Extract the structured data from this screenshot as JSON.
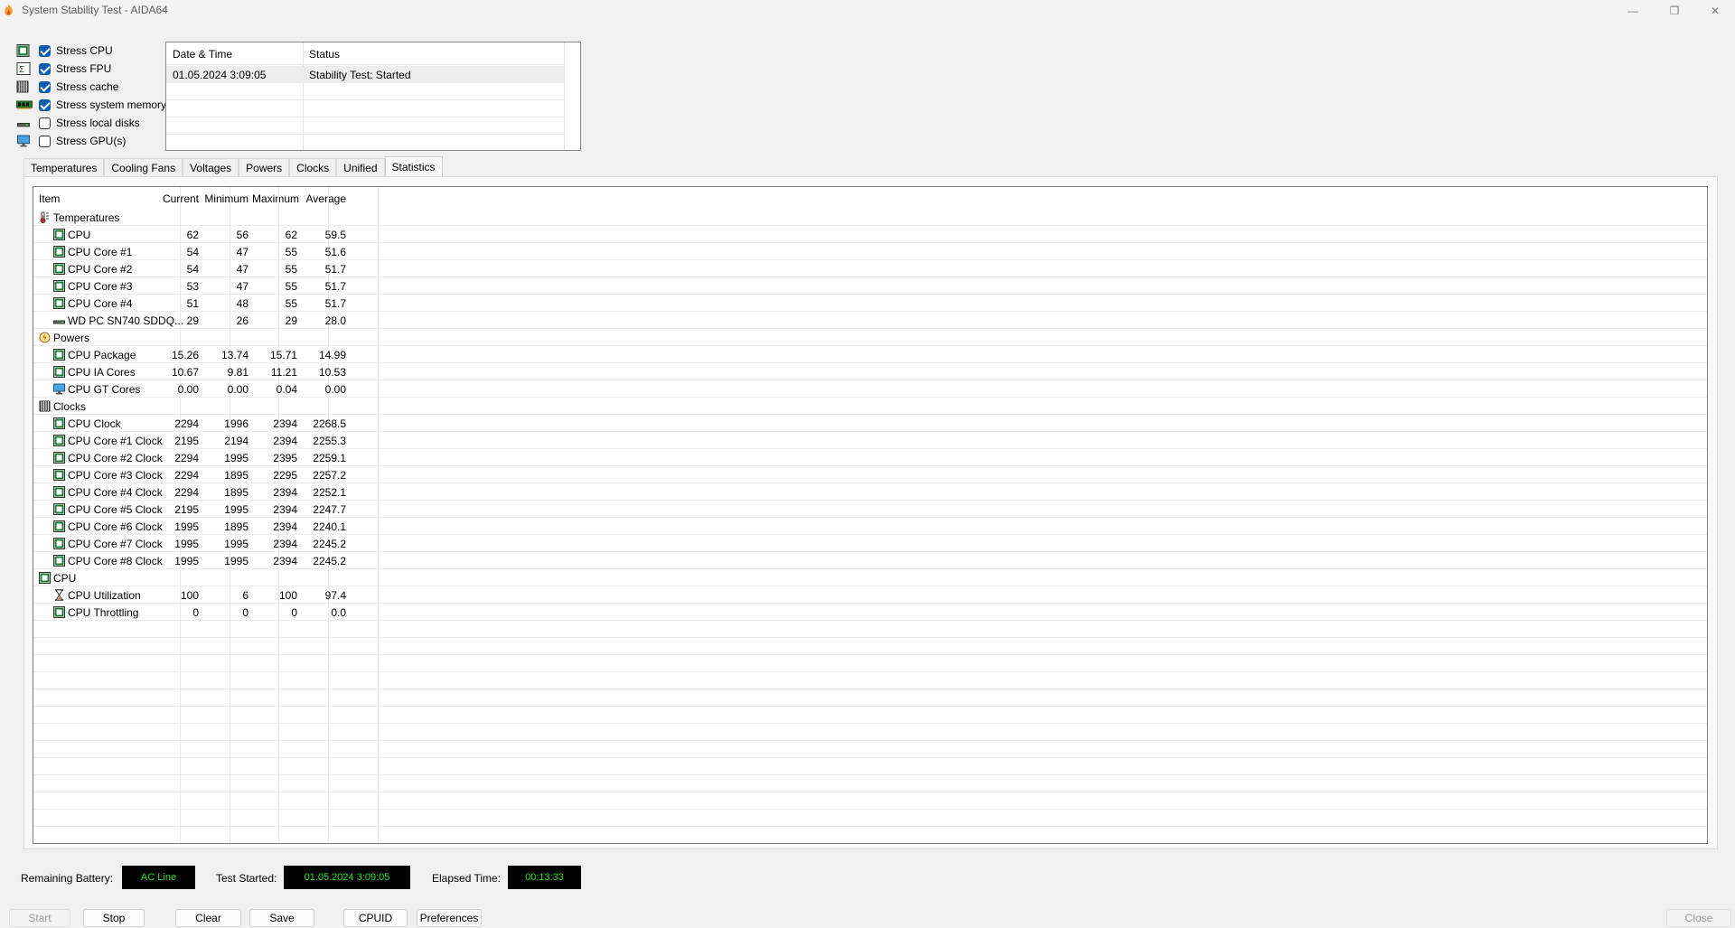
{
  "window": {
    "title": "System Stability Test - AIDA64",
    "controls": {
      "minimize": "—",
      "maximize": "❐",
      "close": "✕"
    }
  },
  "stress": [
    {
      "label": "Stress CPU",
      "checked": true,
      "icon": "cpu-chip-icon"
    },
    {
      "label": "Stress FPU",
      "checked": true,
      "icon": "fpu-icon"
    },
    {
      "label": "Stress cache",
      "checked": true,
      "icon": "cache-icon"
    },
    {
      "label": "Stress system memory",
      "checked": true,
      "icon": "memory-icon"
    },
    {
      "label": "Stress local disks",
      "checked": false,
      "icon": "disk-icon"
    },
    {
      "label": "Stress GPU(s)",
      "checked": false,
      "icon": "monitor-icon"
    }
  ],
  "log": {
    "headers": [
      "Date & Time",
      "Status"
    ],
    "rows": [
      {
        "datetime": "01.05.2024 3:09:05",
        "status": "Stability Test: Started"
      }
    ]
  },
  "tabs": [
    "Temperatures",
    "Cooling Fans",
    "Voltages",
    "Powers",
    "Clocks",
    "Unified",
    "Statistics"
  ],
  "active_tab": "Statistics",
  "grid": {
    "headers": {
      "item": "Item",
      "current": "Current",
      "minimum": "Minimum",
      "maximum": "Maximum",
      "average": "Average"
    },
    "rows": [
      {
        "type": "group",
        "icon": "thermometer-icon",
        "item": "Temperatures"
      },
      {
        "type": "item",
        "icon": "cpu-chip-icon",
        "item": "CPU",
        "current": "62",
        "minimum": "56",
        "maximum": "62",
        "average": "59.5"
      },
      {
        "type": "item",
        "icon": "cpu-chip-icon",
        "item": "CPU Core #1",
        "current": "54",
        "minimum": "47",
        "maximum": "55",
        "average": "51.6"
      },
      {
        "type": "item",
        "icon": "cpu-chip-icon",
        "item": "CPU Core #2",
        "current": "54",
        "minimum": "47",
        "maximum": "55",
        "average": "51.7"
      },
      {
        "type": "item",
        "icon": "cpu-chip-icon",
        "item": "CPU Core #3",
        "current": "53",
        "minimum": "47",
        "maximum": "55",
        "average": "51.7"
      },
      {
        "type": "item",
        "icon": "cpu-chip-icon",
        "item": "CPU Core #4",
        "current": "51",
        "minimum": "48",
        "maximum": "55",
        "average": "51.7"
      },
      {
        "type": "item",
        "icon": "disk-icon",
        "item": "WD PC SN740 SDDQ...",
        "current": "29",
        "minimum": "26",
        "maximum": "29",
        "average": "28.0"
      },
      {
        "type": "group",
        "icon": "power-icon",
        "item": "Powers"
      },
      {
        "type": "item",
        "icon": "cpu-chip-icon",
        "item": "CPU Package",
        "current": "15.26",
        "minimum": "13.74",
        "maximum": "15.71",
        "average": "14.99"
      },
      {
        "type": "item",
        "icon": "cpu-chip-icon",
        "item": "CPU IA Cores",
        "current": "10.67",
        "minimum": "9.81",
        "maximum": "11.21",
        "average": "10.53"
      },
      {
        "type": "item",
        "icon": "monitor-icon",
        "item": "CPU GT Cores",
        "current": "0.00",
        "minimum": "0.00",
        "maximum": "0.04",
        "average": "0.00"
      },
      {
        "type": "group",
        "icon": "cache-icon",
        "item": "Clocks"
      },
      {
        "type": "item",
        "icon": "cpu-chip-icon",
        "item": "CPU Clock",
        "current": "2294",
        "minimum": "1996",
        "maximum": "2394",
        "average": "2268.5"
      },
      {
        "type": "item",
        "icon": "cpu-chip-icon",
        "item": "CPU Core #1 Clock",
        "current": "2195",
        "minimum": "2194",
        "maximum": "2394",
        "average": "2255.3"
      },
      {
        "type": "item",
        "icon": "cpu-chip-icon",
        "item": "CPU Core #2 Clock",
        "current": "2294",
        "minimum": "1995",
        "maximum": "2395",
        "average": "2259.1"
      },
      {
        "type": "item",
        "icon": "cpu-chip-icon",
        "item": "CPU Core #3 Clock",
        "current": "2294",
        "minimum": "1895",
        "maximum": "2295",
        "average": "2257.2"
      },
      {
        "type": "item",
        "icon": "cpu-chip-icon",
        "item": "CPU Core #4 Clock",
        "current": "2294",
        "minimum": "1895",
        "maximum": "2394",
        "average": "2252.1"
      },
      {
        "type": "item",
        "icon": "cpu-chip-icon",
        "item": "CPU Core #5 Clock",
        "current": "2195",
        "minimum": "1995",
        "maximum": "2394",
        "average": "2247.7"
      },
      {
        "type": "item",
        "icon": "cpu-chip-icon",
        "item": "CPU Core #6 Clock",
        "current": "1995",
        "minimum": "1895",
        "maximum": "2394",
        "average": "2240.1"
      },
      {
        "type": "item",
        "icon": "cpu-chip-icon",
        "item": "CPU Core #7 Clock",
        "current": "1995",
        "minimum": "1995",
        "maximum": "2394",
        "average": "2245.2"
      },
      {
        "type": "item",
        "icon": "cpu-chip-icon",
        "item": "CPU Core #8 Clock",
        "current": "1995",
        "minimum": "1995",
        "maximum": "2394",
        "average": "2245.2"
      },
      {
        "type": "group",
        "icon": "cpu-chip-icon",
        "item": "CPU"
      },
      {
        "type": "item",
        "icon": "hourglass-icon",
        "item": "CPU Utilization",
        "current": "100",
        "minimum": "6",
        "maximum": "100",
        "average": "97.4"
      },
      {
        "type": "item",
        "icon": "cpu-chip-icon",
        "item": "CPU Throttling",
        "current": "0",
        "minimum": "0",
        "maximum": "0",
        "average": "0.0"
      }
    ]
  },
  "status": {
    "battery_label": "Remaining Battery:",
    "battery_value": "AC Line",
    "started_label": "Test Started:",
    "started_value": "01.05.2024 3:09:05",
    "elapsed_label": "Elapsed Time:",
    "elapsed_value": "00:13:33"
  },
  "buttons": {
    "start": "Start",
    "stop": "Stop",
    "clear": "Clear",
    "save": "Save",
    "cpuid": "CPUID",
    "preferences": "Preferences",
    "close": "Close"
  },
  "colors": {
    "status_bg": "#000000",
    "status_text": "#27e027",
    "accent_checkbox": "#0b5cad",
    "chip_green": "#1f7a3a"
  }
}
